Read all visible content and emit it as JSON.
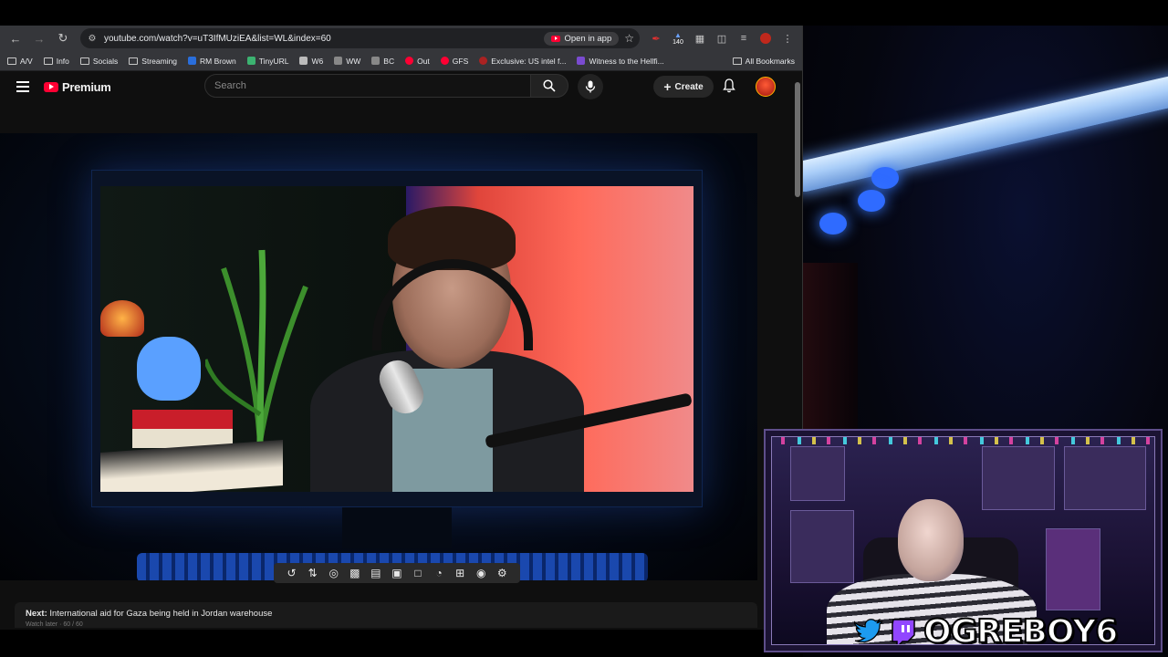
{
  "browser": {
    "url": "youtube.com/watch?v=uT3IfMUziEA&list=WL&index=60",
    "open_in_app_label": "Open in app",
    "bookmarks": [
      {
        "label": "A/V",
        "icon": "folder-icon"
      },
      {
        "label": "Info",
        "icon": "folder-icon"
      },
      {
        "label": "Socials",
        "icon": "folder-icon"
      },
      {
        "label": "Streaming",
        "icon": "folder-icon"
      },
      {
        "label": "RM Brown",
        "icon": "rm-favicon",
        "color": "#2a6edb"
      },
      {
        "label": "TinyURL",
        "icon": "tinyurl-favicon",
        "color": "#3cb371"
      },
      {
        "label": "W6",
        "icon": "w6-favicon",
        "color": "#bbbbbb"
      },
      {
        "label": "WW",
        "icon": "ww-favicon",
        "color": "#888888"
      },
      {
        "label": "BC",
        "icon": "bc-favicon",
        "color": "#888888"
      },
      {
        "label": "Out",
        "icon": "youtube-favicon",
        "color": "#ff0033"
      },
      {
        "label": "GFS",
        "icon": "youtube-favicon",
        "color": "#ff0033"
      },
      {
        "label": "Exclusive: US intel f...",
        "icon": "news-favicon",
        "color": "#aa2222"
      },
      {
        "label": "Witness to the Hellfi...",
        "icon": "news-favicon",
        "color": "#7a4bd0"
      }
    ],
    "all_bookmarks_label": "All Bookmarks",
    "extension_badge": "140"
  },
  "youtube": {
    "logo_text": "Premium",
    "search_placeholder": "Search",
    "create_label": "Create",
    "next_label": "Next:",
    "next_title": "International aid for Gaza being held in Jordan warehouse",
    "next_sub": "Watch later · 60 / 60"
  },
  "overlay": {
    "channel_name": "OGREBOY6"
  },
  "colors": {
    "youtube_red": "#ff0033",
    "twitter_blue": "#1d9bf0",
    "twitch_purple": "#9146ff"
  }
}
